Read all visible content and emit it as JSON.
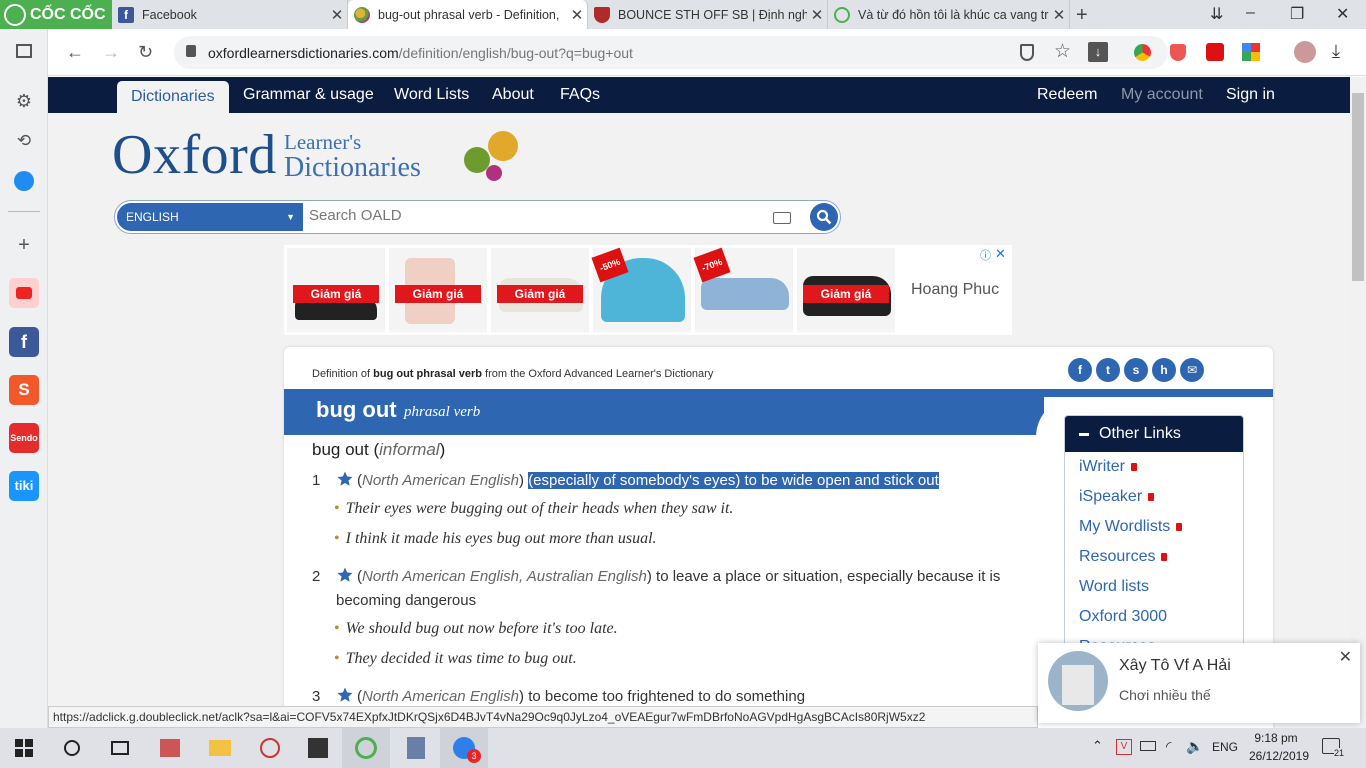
{
  "browser": {
    "brand": "CỐC CỐC",
    "tabs": [
      {
        "title": "Facebook"
      },
      {
        "title": "bug-out phrasal verb - Definition,"
      },
      {
        "title": "BOUNCE STH OFF SB | Định nghĩa"
      },
      {
        "title": "Và từ đó hồn tôi là khúc ca vang tr"
      }
    ],
    "url_host": "oxfordlearnersdictionaries.com",
    "url_path": "/definition/english/bug-out?q=bug+out",
    "status_url": "https://adclick.g.doubleclick.net/aclk?sa=l&ai=COFV5x74EXpfxJtDKrQSjx6D4BJvT4vNa29Oc9q0JyLzo4_oVEAEgur7wFmDBrfoNoAGVpdHgAsgBCAcIs80RjW5xz2"
  },
  "site_nav": {
    "items": [
      "Dictionaries",
      "Grammar & usage",
      "Word Lists",
      "About",
      "FAQs"
    ],
    "right": [
      "Redeem",
      "My account",
      "Sign in"
    ]
  },
  "logo": {
    "oxford": "Oxford",
    "line1": "Learner's",
    "line2": "Dictionaries"
  },
  "search": {
    "language": "ENGLISH",
    "placeholder": "Search OALD"
  },
  "ad": {
    "labels": [
      "Giảm giá",
      "Giảm giá",
      "Giảm giá",
      "Giảm giá"
    ],
    "discounts": [
      "-50%",
      "-70%"
    ],
    "advertiser": "Hoang Phuc"
  },
  "entry": {
    "definition_of_prefix": "Definition of",
    "definition_of_word": "bug out phrasal verb",
    "definition_of_suffix": "from the Oxford Advanced Learner's Dictionary",
    "headword": "bug out",
    "pos": "phrasal verb",
    "phrase": "bug out",
    "phrase_label": "informal",
    "senses": [
      {
        "num": "1",
        "label": "North American English",
        "def": "(especially of somebody's eyes) to be wide open and stick out",
        "examples": [
          "Their eyes were bugging out of their heads when they saw it.",
          "I think it made his eyes bug out more than usual."
        ]
      },
      {
        "num": "2",
        "label": "North American English, Australian English",
        "def": "to leave a place or situation, especially because it is becoming dangerous",
        "examples": [
          "We should bug out now before it's too late.",
          "They decided it was time to bug out."
        ]
      },
      {
        "num": "3",
        "label": "North American English",
        "def": "to become too frightened to do something",
        "examples": []
      }
    ]
  },
  "other_links": {
    "title": "Other Links",
    "items": [
      "iWriter",
      "iSpeaker",
      "My Wordlists",
      "Resources",
      "Word lists",
      "Oxford 3000",
      "Resources"
    ]
  },
  "notification": {
    "title": "Xây Tô Vf A Hải",
    "body": "Chơi nhiều thế"
  },
  "taskbar": {
    "lang": "ENG",
    "time": "9:18 pm",
    "date": "26/12/2019",
    "badge": "3",
    "notif_count": "21"
  },
  "colors": {
    "oxford_blue": "#2e66b1",
    "navy": "#0a1c3f",
    "coccoc_green": "#4caf50"
  }
}
